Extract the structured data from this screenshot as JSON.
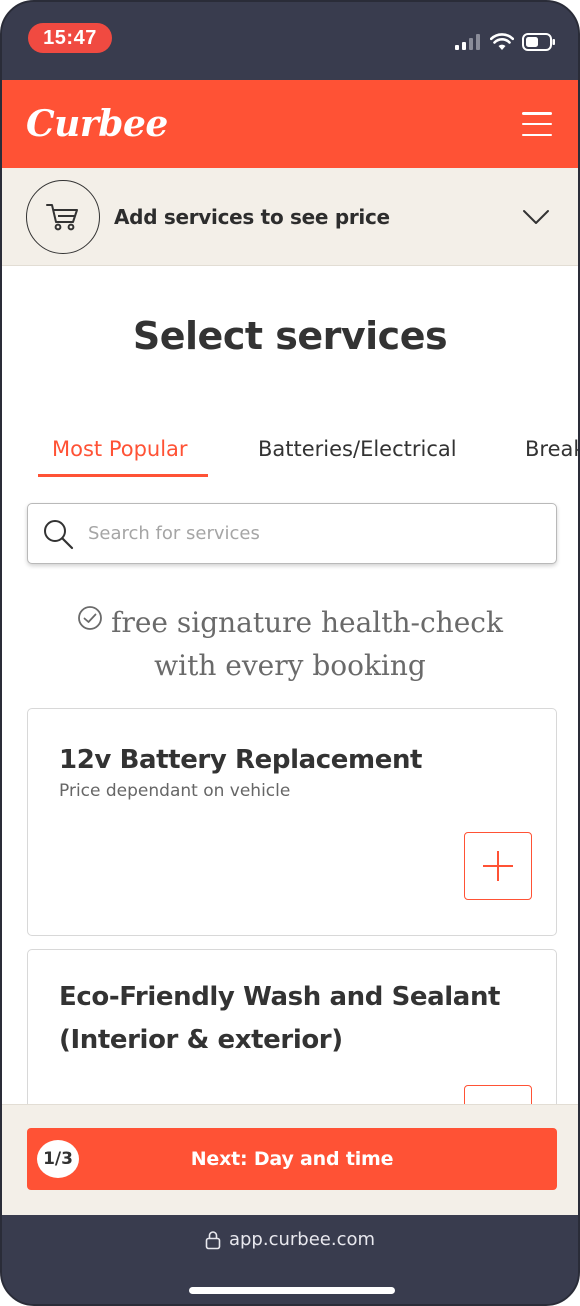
{
  "status_bar": {
    "time": "15:47"
  },
  "header": {
    "logo_text": "Curbee",
    "menu_icon": "hamburger-menu-icon"
  },
  "cart": {
    "label": "Add services to see price",
    "icon": "cart-icon",
    "chevron_icon": "chevron-down-icon"
  },
  "main": {
    "title": "Select services",
    "tabs": [
      {
        "label": "Most Popular",
        "active": true
      },
      {
        "label": "Batteries/Electrical",
        "active": false
      },
      {
        "label": "Break",
        "active": false
      }
    ],
    "search": {
      "placeholder": "Search for services",
      "value": ""
    },
    "promo": {
      "line1": "free signature health-check",
      "line2": "with every booking"
    },
    "services": [
      {
        "title": "12v Battery Replacement",
        "subtitle": "Price dependant on vehicle"
      },
      {
        "title": "Eco-Friendly Wash and Sealant (Interior & exterior)",
        "subtitle": ""
      }
    ]
  },
  "footer": {
    "step": "1/3",
    "next_label": "Next: Day and time"
  },
  "browser": {
    "url": "app.curbee.com"
  },
  "colors": {
    "brand": "#ff5235",
    "status_pill": "#f04a41",
    "bar_background": "#f3efe8",
    "chrome": "#393c4e"
  }
}
